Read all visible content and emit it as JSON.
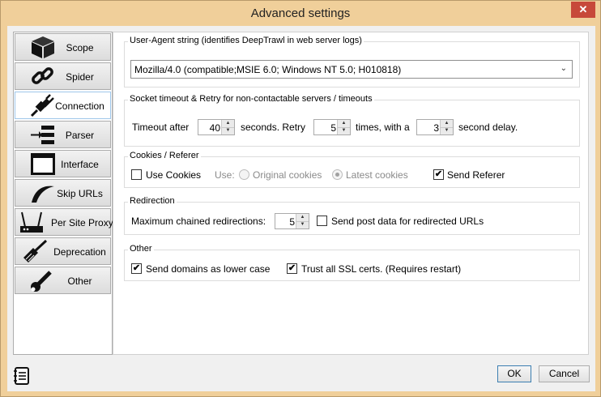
{
  "window": {
    "title": "Advanced settings",
    "close_glyph": "✕"
  },
  "sidebar": {
    "items": [
      {
        "label": "Scope",
        "icon": "cube-icon"
      },
      {
        "label": "Spider",
        "icon": "chain-link-icon"
      },
      {
        "label": "Connection",
        "icon": "plug-icon"
      },
      {
        "label": "Parser",
        "icon": "parser-arrow-icon"
      },
      {
        "label": "Interface",
        "icon": "window-icon"
      },
      {
        "label": "Skip URLs",
        "icon": "boomerang-icon"
      },
      {
        "label": "Per Site Proxy",
        "icon": "router-icon"
      },
      {
        "label": "Deprecation",
        "icon": "broom-icon"
      },
      {
        "label": "Other",
        "icon": "wrench-icon"
      }
    ],
    "active": "Connection"
  },
  "useragent": {
    "legend": "User-Agent string (identifies DeepTrawl in web server logs)",
    "value": "Mozilla/4.0 (compatible;MSIE 6.0; Windows NT 5.0; H010818)"
  },
  "timeout": {
    "legend": "Socket timeout & Retry for non-contactable servers / timeouts",
    "label_timeout": "Timeout after",
    "timeout_value": "40",
    "label_seconds_retry": "seconds.  Retry",
    "retry_value": "5",
    "label_times": "times, with a",
    "delay_value": "3",
    "label_delay": "second delay."
  },
  "cookies": {
    "legend": "Cookies / Referer",
    "use_cookies_label": "Use Cookies",
    "use_cookies_checked": false,
    "use_label": "Use:",
    "original_label": "Original cookies",
    "latest_label": "Latest cookies",
    "send_referer_label": "Send Referer",
    "send_referer_checked": true
  },
  "redirection": {
    "legend": "Redirection",
    "max_label": "Maximum chained redirections:",
    "max_value": "5",
    "post_label": "Send post data for redirected URLs",
    "post_checked": false
  },
  "other": {
    "legend": "Other",
    "lowercase_label": "Send domains as lower case",
    "lowercase_checked": true,
    "ssl_label": "Trust all SSL certs. (Requires restart)",
    "ssl_checked": true
  },
  "buttons": {
    "ok": "OK",
    "cancel": "Cancel"
  },
  "glyphs": {
    "check": "✔",
    "up": "▲",
    "down": "▼",
    "chevron": "⌄"
  }
}
